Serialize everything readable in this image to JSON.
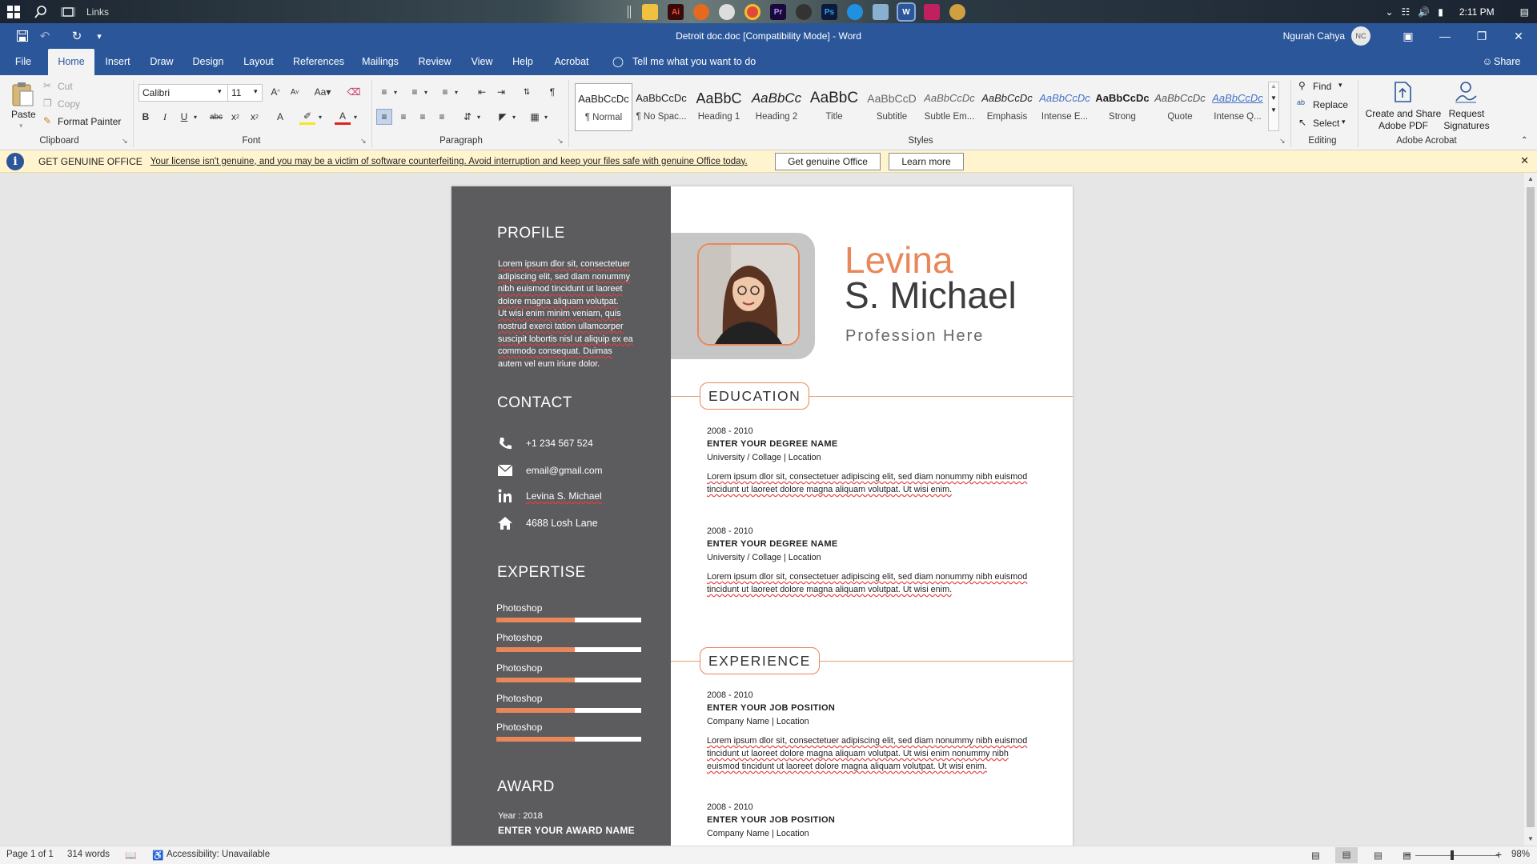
{
  "taskbar": {
    "search_label": "Links",
    "time": "2:11 PM"
  },
  "titlebar": {
    "title": "Detroit doc.doc [Compatibility Mode]  -  Word",
    "user_name": "Ngurah Cahya",
    "user_initials": "NC"
  },
  "tabs": [
    "File",
    "Home",
    "Insert",
    "Draw",
    "Design",
    "Layout",
    "References",
    "Mailings",
    "Review",
    "View",
    "Help",
    "Acrobat"
  ],
  "tell_me": "Tell me what you want to do",
  "share_label": "Share",
  "ribbon": {
    "clipboard": {
      "paste": "Paste",
      "cut": "Cut",
      "copy": "Copy",
      "format_painter": "Format Painter",
      "label": "Clipboard"
    },
    "font": {
      "name": "Calibri",
      "size": "11",
      "label": "Font"
    },
    "paragraph": {
      "label": "Paragraph"
    },
    "styles": {
      "label": "Styles",
      "items": [
        {
          "preview": "AaBbCcDc",
          "name": "¶ Normal"
        },
        {
          "preview": "AaBbCcDc",
          "name": "¶ No Spac..."
        },
        {
          "preview": "AaBbC",
          "name": "Heading 1"
        },
        {
          "preview": "AaBbCc",
          "name": "Heading 2"
        },
        {
          "preview": "AaBbC",
          "name": "Title"
        },
        {
          "preview": "AaBbCcD",
          "name": "Subtitle"
        },
        {
          "preview": "AaBbCcDc",
          "name": "Subtle Em..."
        },
        {
          "preview": "AaBbCcDc",
          "name": "Emphasis"
        },
        {
          "preview": "AaBbCcDc",
          "name": "Intense E..."
        },
        {
          "preview": "AaBbCcDc",
          "name": "Strong"
        },
        {
          "preview": "AaBbCcDc",
          "name": "Quote"
        },
        {
          "preview": "AaBbCcDc",
          "name": "Intense Q..."
        }
      ]
    },
    "editing": {
      "find": "Find",
      "replace": "Replace",
      "select": "Select",
      "label": "Editing"
    },
    "acrobat": {
      "create_line1": "Create and Share",
      "create_line2": "Adobe PDF",
      "request_line1": "Request",
      "request_line2": "Signatures",
      "label": "Adobe Acrobat"
    }
  },
  "infobar": {
    "title": "GET GENUINE OFFICE",
    "message": "Your license isn't genuine, and you may be a victim of software counterfeiting. Avoid interruption and keep your files safe with genuine Office today.",
    "btn_genuine": "Get genuine Office",
    "btn_learn": "Learn more"
  },
  "resume": {
    "profile": {
      "heading": "PROFILE",
      "lines": [
        "Lorem ipsum dlor sit, consectetuer",
        "adipiscing elit, sed diam nonummy",
        "nibh euismod tincidunt ut laoreet",
        "dolore magna aliquam  volutpat.",
        "Ut wisi enim minim veniam, quis",
        "nostrud exerci tation ullamcorper",
        "suscipit lobortis nisl ut aliquip ex ea",
        "commodo consequat. Duimas",
        "autem vel eum iriure dolor."
      ]
    },
    "contact": {
      "heading": "CONTACT",
      "phone": "+1 234 567 524",
      "email": "email@gmail.com",
      "linkedin": "Levina S. Michael",
      "address": "4688 Losh Lane"
    },
    "expertise": {
      "heading": "EXPERTISE",
      "skills": [
        {
          "name": "Photoshop",
          "level": 0.54
        },
        {
          "name": "Photoshop",
          "level": 0.54
        },
        {
          "name": "Photoshop",
          "level": 0.54
        },
        {
          "name": "Photoshop",
          "level": 0.54
        },
        {
          "name": "Photoshop",
          "level": 0.54
        }
      ]
    },
    "award": {
      "heading": "AWARD",
      "year": "Year : 2018",
      "title": "ENTER YOUR AWARD NAME"
    },
    "first_name": "Levina",
    "last_name": "S. Michael",
    "profession": "Profession Here",
    "education": {
      "heading": "EDUCATION",
      "entries": [
        {
          "year": "2008 - 2010",
          "title": "ENTER YOUR DEGREE NAME",
          "sub": "University / Collage | Location",
          "desc1": "Lorem ipsum dlor sit, consectetuer adipiscing elit, sed diam nonummy nibh euismod",
          "desc2": "tincidunt ut laoreet dolore magna aliquam  volutpat. Ut wisi enim."
        },
        {
          "year": "2008 - 2010",
          "title": "ENTER YOUR DEGREE NAME",
          "sub": "University / Collage | Location",
          "desc1": "Lorem ipsum dlor sit, consectetuer adipiscing elit, sed diam nonummy nibh euismod",
          "desc2": "tincidunt ut laoreet dolore magna aliquam  volutpat. Ut wisi enim."
        }
      ]
    },
    "experience": {
      "heading": "EXPERIENCE",
      "entries": [
        {
          "year": "2008 - 2010",
          "title": "ENTER YOUR JOB POSITION",
          "sub": "Company Name | Location",
          "desc1": "Lorem ipsum dlor sit, consectetuer adipiscing elit, sed diam nonummy nibh euismod",
          "desc2": "tincidunt ut laoreet dolore magna aliquam  volutpat. Ut wisi enim  nonummy nibh",
          "desc3": "euismod tincidunt ut laoreet dolore magna aliquam  volutpat. Ut wisi enim."
        },
        {
          "year": "2008 - 2010",
          "title": "ENTER YOUR JOB POSITION",
          "sub": "Company Name | Location"
        }
      ]
    }
  },
  "statusbar": {
    "page": "Page 1 of 1",
    "words": "314 words",
    "accessibility": "Accessibility: Unavailable",
    "zoom": "98%"
  },
  "colors": {
    "word_blue": "#2b579a",
    "accent": "#e8875a",
    "sidebar": "#5c5c5e"
  }
}
